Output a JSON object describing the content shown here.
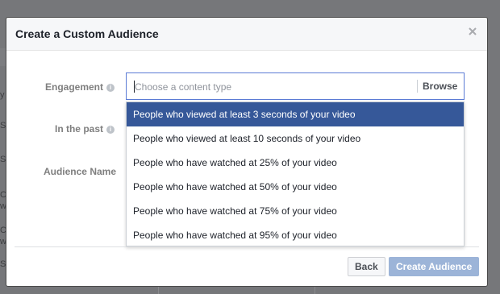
{
  "background": {
    "glyphs": [
      "y",
      "S",
      "S",
      "C",
      "w",
      "C",
      "w",
      "S"
    ]
  },
  "modal": {
    "title": "Create a Custom Audience",
    "close_icon": "close-icon"
  },
  "form": {
    "engagement_label": "Engagement",
    "in_the_past_label": "In the past",
    "audience_name_label": "Audience Name",
    "info_icon": "i",
    "content_type_input": {
      "value": "",
      "placeholder": "Choose a content type"
    },
    "browse_label": "Browse"
  },
  "dropdown": {
    "options": [
      "People who viewed at least 3 seconds of your video",
      "People who viewed at least 10 seconds of your video",
      "People who have watched at 25% of your video",
      "People who have watched at 50% of your video",
      "People who have watched at 75% of your video",
      "People who have watched at 95% of your video"
    ],
    "selected_index": 0
  },
  "footer": {
    "back_label": "Back",
    "create_label": "Create Audience"
  },
  "colors": {
    "selected_option_bg": "#365899",
    "primary_disabled_bg": "#9cb4d8",
    "input_focus_border": "#5b7bd5"
  }
}
